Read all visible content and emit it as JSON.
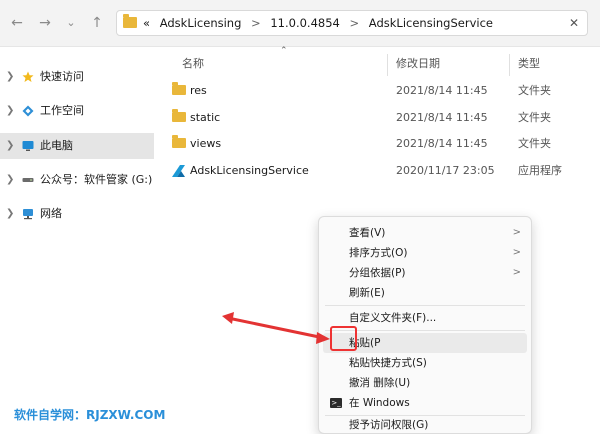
{
  "nav": {
    "back": "←",
    "forward": "→",
    "recent": "⌄",
    "up": "↑"
  },
  "address": {
    "overflow": "«",
    "crumbs": [
      "AdskLicensing",
      "11.0.0.4854",
      "AdskLicensingService"
    ],
    "sep": ">",
    "close": "✕"
  },
  "sidebar": {
    "items": [
      {
        "label": "快速访问",
        "icon": "star-icon"
      },
      {
        "label": "工作空间",
        "icon": "workspace-icon"
      },
      {
        "label": "此电脑",
        "icon": "pc-icon",
        "selected": true
      },
      {
        "label": "公众号：软件管家 (G:)",
        "icon": "drive-icon"
      },
      {
        "label": "网络",
        "icon": "network-icon"
      }
    ]
  },
  "columns": {
    "name": "名称",
    "modified": "修改日期",
    "type": "类型"
  },
  "files": [
    {
      "name": "res",
      "modified": "2021/8/14 11:45",
      "type": "文件夹"
    },
    {
      "name": "static",
      "modified": "2021/8/14 11:45",
      "type": "文件夹"
    },
    {
      "name": "views",
      "modified": "2021/8/14 11:45",
      "type": "文件夹"
    },
    {
      "name": "AdskLicensingService",
      "modified": "2020/11/17 23:05",
      "type": "应用程序"
    }
  ],
  "menu": {
    "view": "查看(V)",
    "sort": "排序方式(O)",
    "group": "分组依据(P)",
    "refresh": "刷新(E)",
    "customize": "自定义文件夹(F)...",
    "paste": "粘贴(P",
    "paste_shortcut": "粘贴快捷方式(S)",
    "undo": "撤消 删除(U)",
    "terminal": "在 Windows",
    "access": "授予访问权限(G)",
    "submenu_arrow": ">"
  },
  "watermark": "软件自学网：RJZXW.COM",
  "colors": {
    "accent": "#e33333",
    "folder": "#e9b73a",
    "watermark": "#2a8fd9"
  }
}
